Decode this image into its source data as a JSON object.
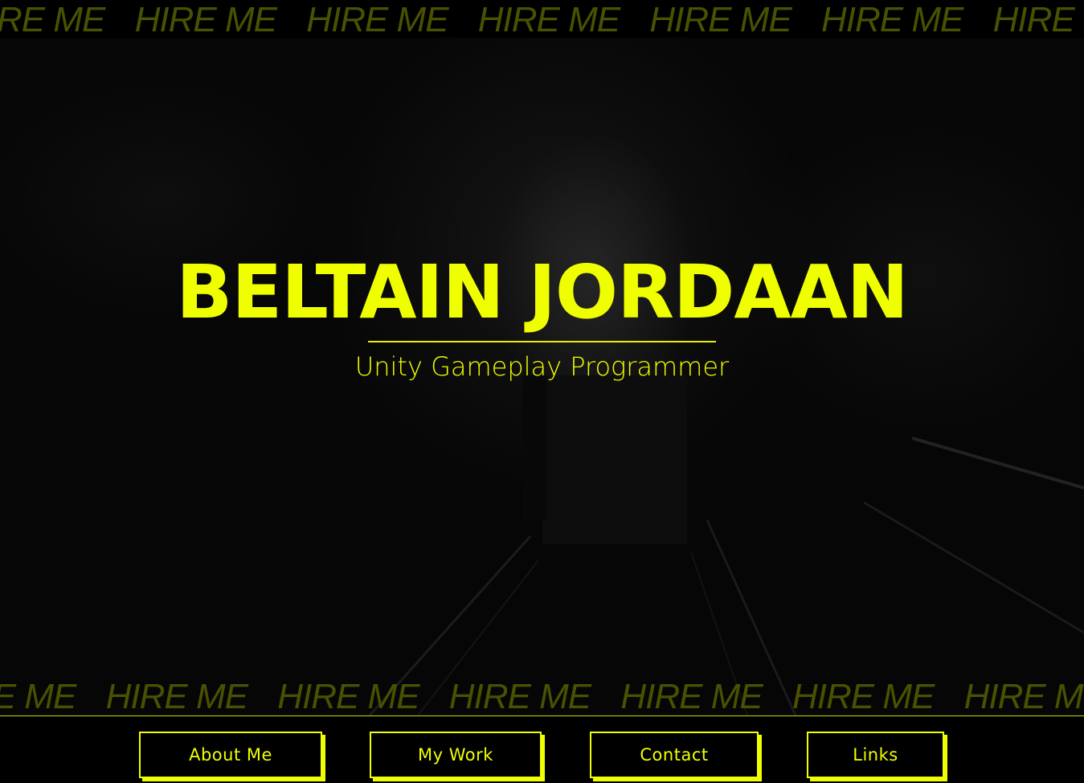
{
  "marquee": {
    "text": "HIRE ME",
    "color": "#4a5100"
  },
  "hero": {
    "name": "BELTAIN JORDAAN",
    "subtitle": "Unity Gameplay Programmer",
    "accent_color": "#f0ff00"
  },
  "nav": {
    "items": [
      {
        "label": "About Me"
      },
      {
        "label": "My Work"
      },
      {
        "label": "Contact"
      },
      {
        "label": "Links"
      }
    ]
  }
}
